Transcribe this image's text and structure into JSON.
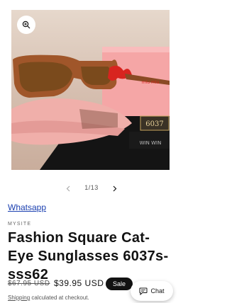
{
  "gallery": {
    "zoom_icon": "magnifier-plus-icon",
    "image_texts": {
      "brand_on_arm": "miu miu",
      "box_model": "6037",
      "box_brand": "WIN WIN"
    },
    "colors": {
      "frame": "#a0562a",
      "lens": "#7a4a1c",
      "pouch": "#f2b4b0",
      "box": "#f7a8a8",
      "floor": "#141414"
    }
  },
  "pagination": {
    "prev_icon": "chevron-left-icon",
    "next_icon": "chevron-right-icon",
    "count": "1/13"
  },
  "links": {
    "whatsapp": "Whatsapp"
  },
  "product": {
    "vendor": "MYSITE",
    "title": "Fashion Square Cat-Eye Sunglasses 6037s-sss62",
    "compare_price": "$67.95 USD",
    "price": "$39.95 USD",
    "badge": "Sale",
    "shipping_link": "Shipping",
    "shipping_text": " calculated at checkout."
  },
  "chat": {
    "label": "Chat",
    "icon": "chat-bubble-icon"
  }
}
